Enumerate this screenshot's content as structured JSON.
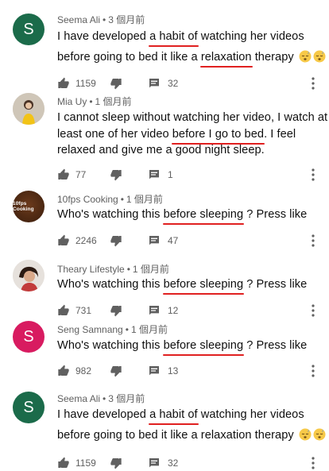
{
  "colors": {
    "avatar_green": "#1b6b4a",
    "avatar_pink": "#d81b60",
    "highlight": "#e02020",
    "secondary_text": "#606060"
  },
  "comments": [
    {
      "author": "Seema Ali",
      "time": "3 個月前",
      "avatar_letter": "S",
      "lines": [
        {
          "parts": [
            "I have developed ",
            "a habit of",
            " watching her videos"
          ]
        },
        {
          "parts": [
            "before going to bed it like a ",
            "relaxation",
            " therapy "
          ]
        }
      ],
      "likes": "1159",
      "replies": "32"
    },
    {
      "author": "Mia Uy",
      "time": "1 個月前",
      "lines": [
        {
          "parts": [
            "I cannot sleep without watching her video, I watch at"
          ]
        },
        {
          "parts": [
            "least one of her video ",
            "before I go to bed",
            ". I feel"
          ]
        },
        {
          "parts": [
            "relaxed and give me a good night sleep."
          ]
        }
      ],
      "likes": "77",
      "replies": "1"
    },
    {
      "author": "10fps Cooking",
      "time": "1 個月前",
      "avatar_text": "10fps Cooking",
      "lines": [
        {
          "parts": [
            "Who's watching this ",
            "before sleeping",
            " ? Press like"
          ]
        }
      ],
      "likes": "2246",
      "replies": "47"
    },
    {
      "author": "Theary Lifestyle",
      "time": "1 個月前",
      "lines": [
        {
          "parts": [
            "Who's watching this ",
            "before sleeping",
            " ? Press like"
          ]
        }
      ],
      "likes": "731",
      "replies": "12"
    },
    {
      "author": "Seng Samnang",
      "time": "1 個月前",
      "avatar_letter": "S",
      "lines": [
        {
          "parts": [
            "Who's watching this ",
            "before sleeping",
            " ? Press like"
          ]
        }
      ],
      "likes": "982",
      "replies": "13"
    },
    {
      "author": "Seema Ali",
      "time": "3 個月前",
      "avatar_letter": "S",
      "lines": [
        {
          "parts": [
            "I have developed ",
            "a habit of",
            " watching her videos"
          ]
        },
        {
          "parts": [
            "before going to bed it like a relaxation therapy "
          ]
        }
      ],
      "likes": "1159",
      "replies": "32"
    }
  ],
  "icons": {
    "like": "thumbs-up-icon",
    "dislike": "thumbs-down-icon",
    "reply": "reply-comment-icon",
    "more": "more-vertical-icon",
    "emoji": "sleeping-face-emoji"
  }
}
